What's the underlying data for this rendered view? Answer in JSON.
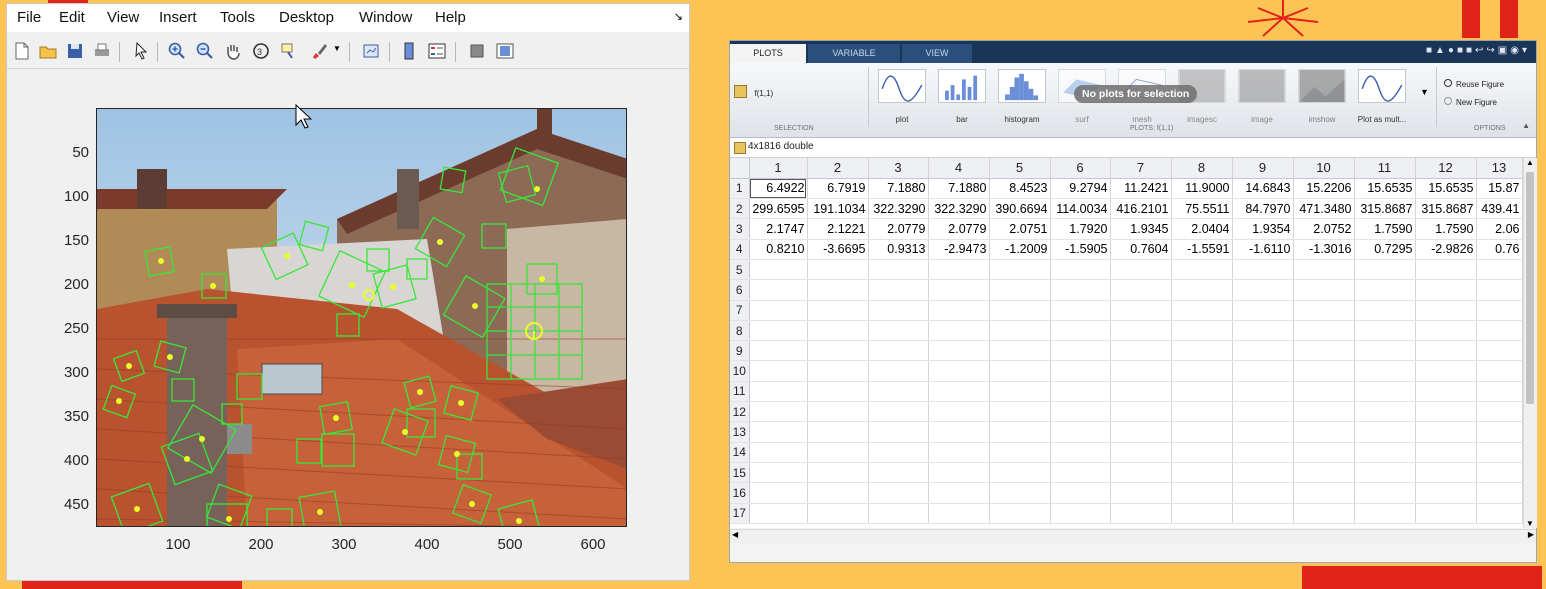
{
  "figure_window": {
    "menu": [
      "File",
      "Edit",
      "View",
      "Insert",
      "Tools",
      "Desktop",
      "Window",
      "Help"
    ],
    "toolbar_icons": [
      "new-figure-icon",
      "open-file-icon",
      "save-icon",
      "print-icon",
      "pointer-icon",
      "zoom-in-icon",
      "zoom-out-icon",
      "pan-icon",
      "rotate-3d-icon",
      "data-cursor-icon",
      "brush-icon",
      "link-plot-icon",
      "colorbar-icon",
      "legend-icon",
      "hide-plot-tools-icon",
      "show-plot-tools-icon"
    ],
    "axes": {
      "yticks": [
        "50",
        "100",
        "150",
        "200",
        "250",
        "300",
        "350",
        "400",
        "450"
      ],
      "xticks": [
        "100",
        "200",
        "300",
        "400",
        "500",
        "600"
      ],
      "xlim": [
        0,
        640
      ],
      "ylim": [
        0,
        480
      ],
      "image_content": "rooftops photograph with green feature-point boxes",
      "feature_color": "#39e639"
    }
  },
  "matlab": {
    "tabs": [
      "PLOTS",
      "VARIABLE",
      "VIEW"
    ],
    "active_tab": "PLOTS",
    "selection": {
      "variable": "f(1,1)",
      "label": "SELECTION"
    },
    "gallery": [
      {
        "name": "plot",
        "icon": "plot-icon"
      },
      {
        "name": "bar",
        "icon": "bar-icon"
      },
      {
        "name": "histogram",
        "icon": "histogram-icon"
      },
      {
        "name": "surf",
        "icon": "surf-icon"
      },
      {
        "name": "mesh",
        "icon": "mesh-icon"
      },
      {
        "name": "imagesc",
        "icon": "imagesc-icon"
      },
      {
        "name": "image",
        "icon": "image-icon"
      },
      {
        "name": "imshow",
        "icon": "imshow-icon"
      },
      {
        "name": "Plot as mult...",
        "icon": "plot-multiple-icon"
      }
    ],
    "no_plots_message": "No plots for selection",
    "plots_label": "PLOTS: f(1,1)",
    "options": {
      "reuse": "Reuse Figure",
      "new": "New Figure",
      "label": "OPTIONS"
    },
    "variable_info": "4x1816 double",
    "columns": [
      "1",
      "2",
      "3",
      "4",
      "5",
      "6",
      "7",
      "8",
      "9",
      "10",
      "11",
      "12",
      "13"
    ],
    "rows": [
      [
        "6.4922",
        "6.7919",
        "7.1880",
        "7.1880",
        "8.4523",
        "9.2794",
        "11.2421",
        "11.9000",
        "14.6843",
        "15.2206",
        "15.6535",
        "15.6535",
        "15.87"
      ],
      [
        "299.6595",
        "191.1034",
        "322.3290",
        "322.3290",
        "390.6694",
        "114.0034",
        "416.2101",
        "75.5511",
        "84.7970",
        "471.3480",
        "315.8687",
        "315.8687",
        "439.41"
      ],
      [
        "2.1747",
        "2.1221",
        "2.0779",
        "2.0779",
        "2.0751",
        "1.7920",
        "1.9345",
        "2.0404",
        "1.9354",
        "2.0752",
        "1.7590",
        "1.7590",
        "2.06"
      ],
      [
        "0.8210",
        "-3.6695",
        "0.9313",
        "-2.9473",
        "-1.2009",
        "-1.5905",
        "0.7604",
        "-1.5591",
        "-1.6110",
        "-1.3016",
        "0.7295",
        "-2.9826",
        "0.76"
      ]
    ],
    "row_headers": [
      "1",
      "2",
      "3",
      "4",
      "5",
      "6",
      "7",
      "8",
      "9",
      "10",
      "11",
      "12",
      "13",
      "14",
      "15",
      "16",
      "17"
    ]
  }
}
